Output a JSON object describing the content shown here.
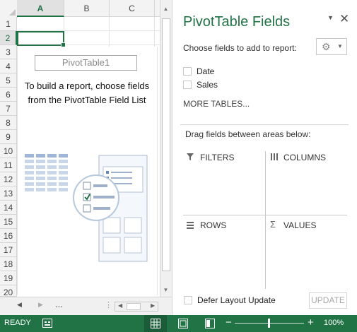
{
  "sheet": {
    "columns": [
      "A",
      "B",
      "C"
    ],
    "rows": [
      "1",
      "2",
      "3",
      "4",
      "5",
      "6",
      "7",
      "8",
      "9",
      "10",
      "11",
      "12",
      "13",
      "14",
      "15",
      "16",
      "17",
      "18",
      "19",
      "20"
    ],
    "pivot_name": "PivotTable1",
    "pivot_message": "To build a report, choose fields from the PivotTable Field List"
  },
  "sheetbar": {
    "ellipsis": "..."
  },
  "status": {
    "ready": "READY",
    "zoom": "100%"
  },
  "pane": {
    "title": "PivotTable Fields",
    "choose_label": "Choose fields to add to report:",
    "fields": [
      {
        "label": "Date",
        "checked": false
      },
      {
        "label": "Sales",
        "checked": false
      }
    ],
    "more_tables": "MORE TABLES...",
    "drag_label": "Drag fields between areas below:",
    "areas": {
      "filters": "FILTERS",
      "columns": "COLUMNS",
      "rows": "ROWS",
      "values": "VALUES"
    },
    "defer_label": "Defer Layout Update",
    "update_label": "UPDATE"
  },
  "colors": {
    "accent": "#217346",
    "grid": "#e3e3e3"
  }
}
